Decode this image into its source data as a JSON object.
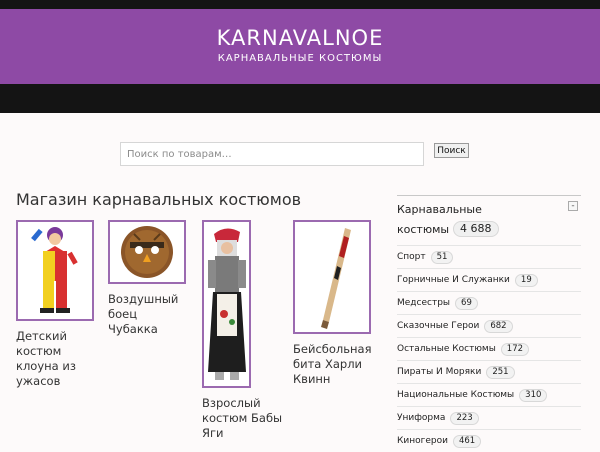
{
  "site": {
    "title": "KARNAVALNOE",
    "subtitle": "КАРНАВАЛЬНЫЕ КОСТЮМЫ"
  },
  "search": {
    "placeholder": "Поиск по товарам…",
    "button_label": "Поиск"
  },
  "main": {
    "title": "Магазин карнавальных костюмов",
    "products": [
      {
        "name": "Детский костюм клоуна из ужасов"
      },
      {
        "name": "Воздушный боец Чубакка"
      },
      {
        "name": "Взрослый костюм Бабы Яги"
      },
      {
        "name": "Бейсбольная бита Харли Квинн"
      }
    ]
  },
  "sidebar": {
    "heading": "Карнавальные костюмы",
    "heading_count": "4 688",
    "collapse_symbol": "-",
    "categories": [
      {
        "label": "Спорт",
        "count": "51"
      },
      {
        "label": "Горничные И Служанки",
        "count": "19"
      },
      {
        "label": "Медсестры",
        "count": "69"
      },
      {
        "label": "Сказочные Герои",
        "count": "682"
      },
      {
        "label": "Остальные Костюмы",
        "count": "172"
      },
      {
        "label": "Пираты И Моряки",
        "count": "251"
      },
      {
        "label": "Национальные Костюмы",
        "count": "310"
      },
      {
        "label": "Униформа",
        "count": "223"
      },
      {
        "label": "Киногерои",
        "count": "461"
      }
    ]
  },
  "colors": {
    "header": "#8e4aa5",
    "bars": "#141414",
    "thumb_border": "#9b6ab0",
    "background": "#fdfafa"
  },
  "icons": {
    "sidebar_toggle": "collapse-icon"
  }
}
